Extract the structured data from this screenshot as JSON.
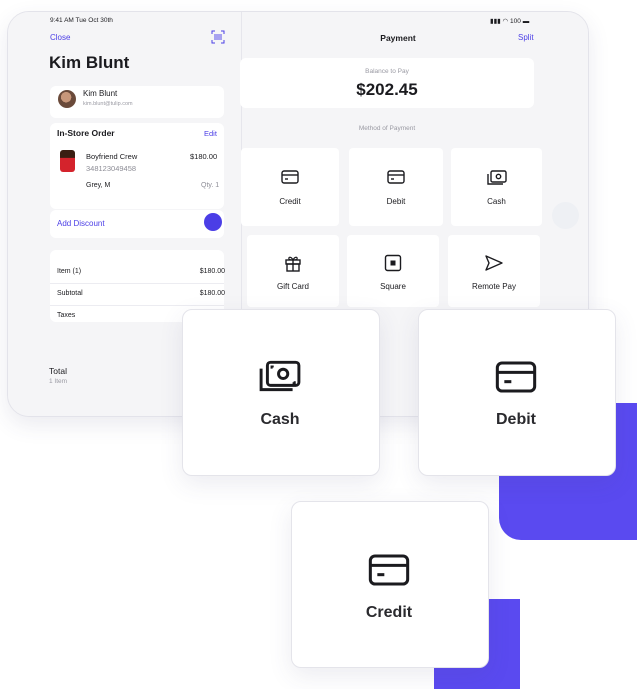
{
  "status": {
    "time": "9:41 AM  Tue Oct 30th",
    "battery": "100"
  },
  "left": {
    "close": "Close",
    "customer_title": "Kim Blunt",
    "customer": {
      "name": "Kim Blunt",
      "email": "kim.blunt@tulip.com"
    },
    "order": {
      "title": "In-Store Order",
      "edit": "Edit",
      "product": {
        "name": "Boyfriend Crew",
        "sku": "348123049458",
        "price": "$180.00",
        "variant": "Grey, M",
        "qty": "Qty. 1"
      }
    },
    "discount": "Add Discount",
    "rows": [
      {
        "label": "Item (1)",
        "value": "$180.00"
      },
      {
        "label": "Subtotal",
        "value": "$180.00"
      },
      {
        "label": "Taxes",
        "value": ""
      }
    ],
    "total": {
      "label": "Total",
      "items": "1 Item"
    }
  },
  "payment": {
    "title": "Payment",
    "split": "Split",
    "balance_label": "Balance to Pay",
    "balance_value": "$202.45",
    "method_label": "Method of Payment",
    "methods": [
      {
        "label": "Credit",
        "icon": "card-icon"
      },
      {
        "label": "Debit",
        "icon": "card-icon"
      },
      {
        "label": "Cash",
        "icon": "cash-icon"
      },
      {
        "label": "Gift Card",
        "icon": "gift-icon"
      },
      {
        "label": "Square",
        "icon": "square-icon"
      },
      {
        "label": "Remote Pay",
        "icon": "send-icon"
      }
    ]
  },
  "floating": [
    {
      "label": "Cash",
      "icon": "cash-icon"
    },
    {
      "label": "Debit",
      "icon": "card-icon"
    },
    {
      "label": "Credit",
      "icon": "card-icon"
    }
  ],
  "colors": {
    "accent": "#4b3ee6",
    "deco": "#5a4af0",
    "background": "#f5f5f7"
  }
}
